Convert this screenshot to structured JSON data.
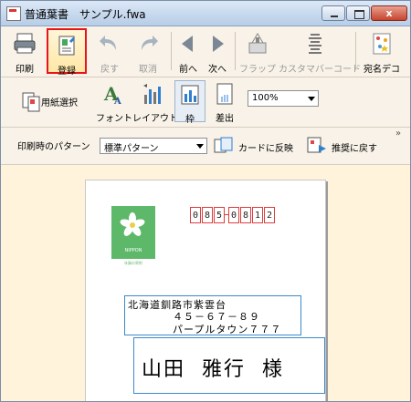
{
  "window": {
    "title": "普通葉書　サンプル.fwa",
    "close": "x"
  },
  "toolbar_main": {
    "print": "印刷",
    "register": "登録",
    "undo": "戻す",
    "cancel": "取消",
    "prev": "前へ",
    "next": "次へ",
    "flap": "フラップ",
    "custom_barcode": "カスタマバーコード",
    "addressee_deco": "宛名デコ"
  },
  "toolbar_format": {
    "paper_select": "用紙選択",
    "font": "フォント",
    "layout": "レイアウト",
    "frame": "枠",
    "sender": "差出",
    "zoom": "100%"
  },
  "toolbar_pattern": {
    "label": "印刷時のパターン",
    "selected": "標準パターン",
    "reflect_card": "カードに反映",
    "restore_recommended": "推奨に戻す",
    "more": "»"
  },
  "postcard": {
    "zip_digits": [
      "0",
      "8",
      "5",
      "0",
      "8",
      "1",
      "2"
    ],
    "stamp_text": "NIPPON",
    "stamp_caption": "年賀の寄附",
    "address_lines": [
      "北海道釧路市紫雲台",
      "４５－６７－８９",
      "パープルタウン７７７"
    ],
    "name": [
      "山田",
      "雅行",
      "様"
    ]
  },
  "colors": {
    "highlight": "#e8141a",
    "stamp": "#5db86a",
    "zip_border": "#e03c3c",
    "frame_border": "#3d89c9"
  }
}
